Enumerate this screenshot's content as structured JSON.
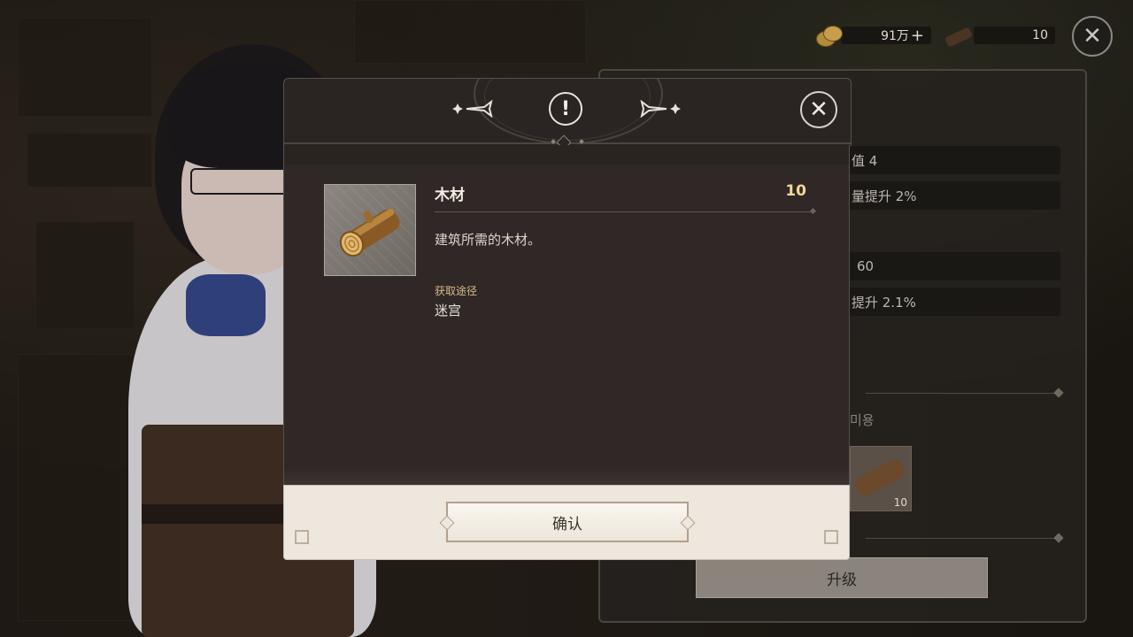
{
  "hud": {
    "gold": "91万",
    "gold_add": "+",
    "wood": "10",
    "close_symbol": "✕"
  },
  "background_panel": {
    "stats": [
      "值 4",
      "量提升 2%",
      "60",
      "提升 2.1%"
    ],
    "cost_label": "미용",
    "cost_item_qty": "10",
    "upgrade_label": "升级"
  },
  "dialog": {
    "alert_symbol": "!",
    "close_symbol": "✕",
    "item": {
      "name": "木材",
      "count": "10",
      "description": "建筑所需的木材。",
      "source_title": "获取途径",
      "source_value": "迷宫"
    },
    "confirm_label": "确认"
  },
  "icons": {
    "hud_gold": "coin-icon",
    "hud_wood": "log-icon",
    "alert": "exclamation-circle-icon",
    "close": "close-icon",
    "item": "wood-log-icon"
  },
  "colors": {
    "dialog_bg": "#2f2826",
    "footer_bg": "#ede7de",
    "count_accent": "#f0d89a",
    "source_title": "#d6b98a"
  }
}
